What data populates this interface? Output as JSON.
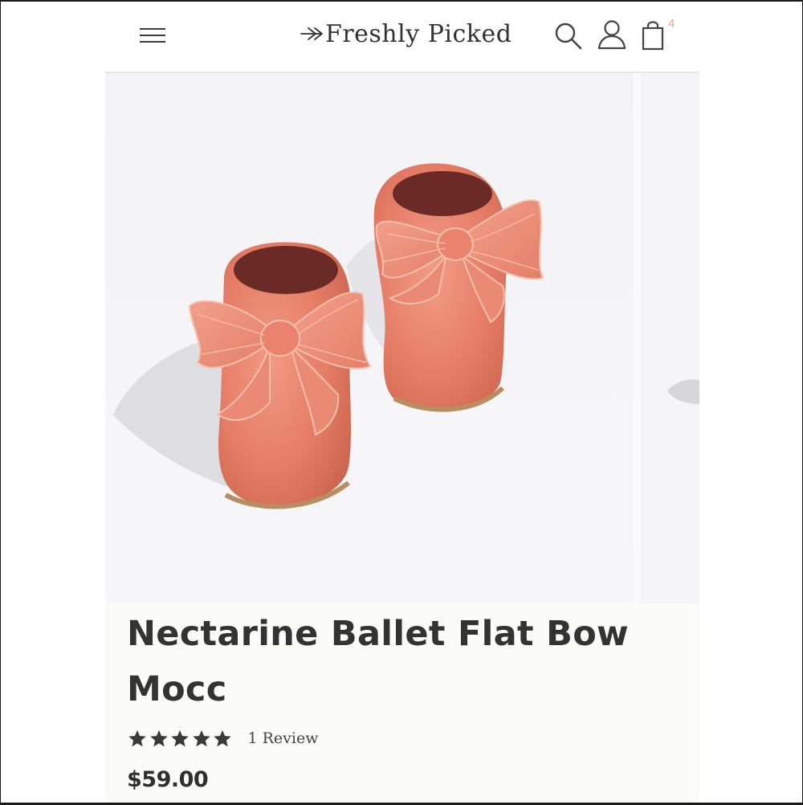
{
  "header": {
    "brand": "Freshly Picked",
    "cart_count": "4",
    "icons": [
      "menu-icon",
      "search-icon",
      "user-icon",
      "cart-icon"
    ]
  },
  "product": {
    "title": "Nectarine Ballet Flat Bow Mocc",
    "rating": 5,
    "review_text": "1 Review",
    "price": "$59.00",
    "image": "nectarine-bow-moccasins-photo"
  },
  "colors": {
    "text": "#333333",
    "cart_badge": "#e3a38c",
    "shoe": "#e57f68",
    "bow": "#ec8f7a"
  }
}
